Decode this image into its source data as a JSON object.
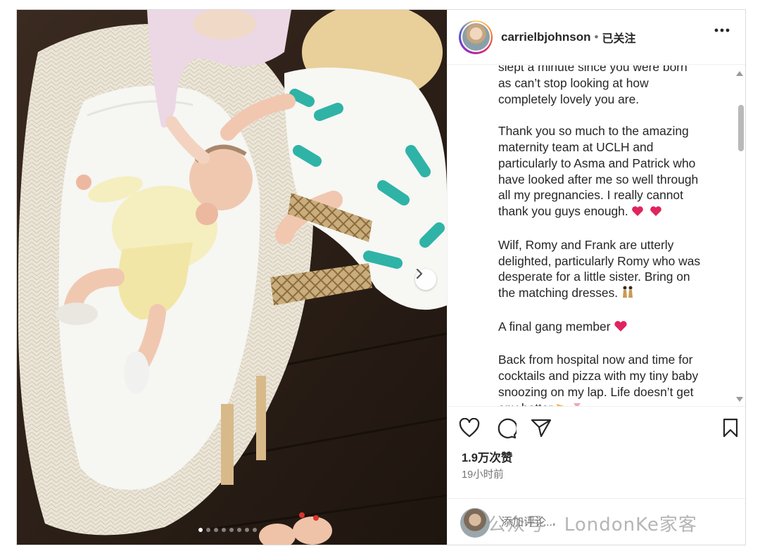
{
  "post": {
    "username": "carrielbjohnson",
    "separator": "•",
    "follow_status": "已关注",
    "caption_paragraphs": [
      "slept a minute since you were born\nas can’t stop looking at how\ncompletely lovely you are.",
      "Thank you so much to the amazing\nmaternity team at UCLH and\nparticularly to Asma and Patrick who\nhave looked after me so well through\nall my pregnancies. I really cannot\nthank you guys enough.",
      "Wilf, Romy and Frank are utterly\ndelighted, particularly Romy who was\ndesperate for a little sister. Bring on\nthe matching dresses.",
      "A final gang member",
      "Back from hospital now and time for\ncocktails and pizza with my tiny baby\nsnoozing on my lap. Life doesn’t get\nany better"
    ],
    "caption_emojis": [
      "two-hearts",
      "two-women-dancing",
      "pink-heart",
      "pizza-cocktail"
    ],
    "likes": "1.9万次赞",
    "time_ago": "19小时前",
    "comment_placeholder": "添加评论...",
    "carousel": {
      "total": 8,
      "current": 1
    }
  },
  "watermark": "公众号 · LondonKe家客",
  "colors": {
    "accent_heart": "#e0245e",
    "muted": "#737373",
    "border": "#dbdbdb"
  },
  "icons": [
    "more-icon",
    "heart-icon",
    "comment-icon",
    "share-icon",
    "bookmark-icon",
    "chevron-right-icon"
  ]
}
